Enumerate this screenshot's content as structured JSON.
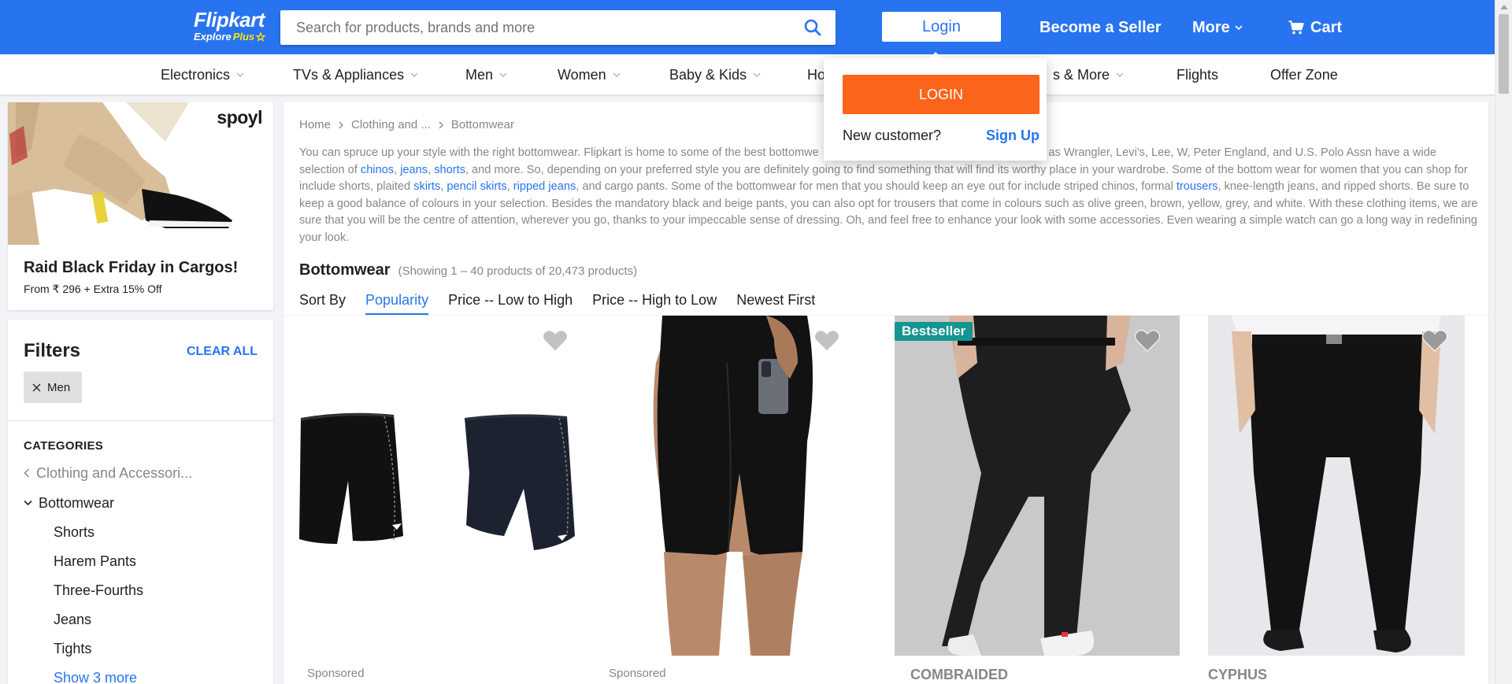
{
  "header": {
    "logo_text": "Flipkart",
    "logo_sub": "Explore",
    "logo_plus": "Plus",
    "search_placeholder": "Search for products, brands and more",
    "login_label": "Login",
    "seller_label": "Become a Seller",
    "more_label": "More",
    "cart_label": "Cart"
  },
  "nav": {
    "items": [
      "Electronics",
      "TVs & Appliances",
      "Men",
      "Women",
      "Baby & Kids",
      "Ho",
      "s & More",
      "Flights",
      "Offer Zone"
    ]
  },
  "login_popup": {
    "button": "LOGIN",
    "new_customer": "New customer?",
    "signup": "Sign Up"
  },
  "ad": {
    "brand": "spoyl",
    "title": "Raid Black Friday in Cargos!",
    "subtitle": "From ₹ 296 + Extra 15% Off"
  },
  "filters": {
    "title": "Filters",
    "clear_all": "CLEAR ALL",
    "chip": "Men",
    "categories_label": "CATEGORIES",
    "parent": "Clothing and Accessori...",
    "current": "Bottomwear",
    "subcategories": [
      "Shorts",
      "Harem Pants",
      "Three-Fourths",
      "Jeans",
      "Tights"
    ],
    "show_more": "Show 3 more"
  },
  "breadcrumb": [
    "Home",
    "Clothing and ...",
    "Bottomwear"
  ],
  "description": {
    "p1": "You can spruce up your style with the right bottomwear. Flipkart is home to some of the best bottomwe",
    "p1b": "uch as Wrangler, Levi's, Lee, W, Peter England, and U.S. Polo Assn have a wide selection of ",
    "l1": "chinos",
    "s1": ", ",
    "l2": "jeans",
    "s2": ", ",
    "l3": "shorts",
    "p2": ", and more. So, depending on your preferred style you are definitely going to find something that will find its worthy place in your wardrobe. Some of the bottom wear for women that you can shop for include shorts, plaited ",
    "l4": "skirts",
    "s3": ", ",
    "l5": "pencil skirts",
    "s4": ", ",
    "l6": "ripped jeans",
    "p3": ", and cargo pants. Some of the bottomwear for men that you should keep an eye out for include striped chinos, formal ",
    "l7": "trousers",
    "p4": ", knee-length jeans, and ripped shorts. Be sure to keep a good balance of colours in your selection. Besides the mandatory black and beige pants, you can also opt for trousers that come in colours such as olive green, brown, yellow, grey, and white. With these clothing items, we are sure that you will be the centre of attention, wherever you go, thanks to your impeccable sense of dressing. Oh, and feel free to enhance your look with some accessories. Even wearing a simple watch can go a long way in redefining your look."
  },
  "results": {
    "title": "Bottomwear",
    "count": "(Showing 1 – 40 products of 20,473 products)"
  },
  "sort": {
    "label": "Sort By",
    "options": [
      "Popularity",
      "Price -- Low to High",
      "Price -- High to Low",
      "Newest First"
    ],
    "active": "Popularity"
  },
  "products": [
    {
      "label": "Sponsored"
    },
    {
      "label": "Sponsored"
    },
    {
      "badge": "Bestseller",
      "brand": "COMBRAIDED"
    },
    {
      "brand": "CYPHUS"
    }
  ],
  "colors": {
    "brand_blue": "#2874f0",
    "login_orange": "#fb641b",
    "bestseller_teal": "#14958f"
  }
}
